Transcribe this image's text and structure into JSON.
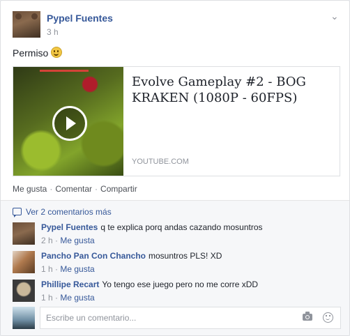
{
  "post": {
    "author": "Pypel Fuentes",
    "time": "3 h",
    "status_text": "Permiso",
    "link": {
      "title": "Evolve Gameplay #2 - BOG KRAKEN (1080P - 60FPS)",
      "domain": "YOUTUBE.COM"
    },
    "actions": {
      "like": "Me gusta",
      "comment": "Comentar",
      "share": "Compartir",
      "separator": "·"
    }
  },
  "comments": {
    "view_more": "Ver 2 comentarios más",
    "items": [
      {
        "name": "Pypel Fuentes",
        "text": "q te explica porq andas cazando mosuntros",
        "time": "2 h",
        "like": "Me gusta",
        "dot": "·"
      },
      {
        "name": "Pancho Pan Con Chancho",
        "text": "mosuntros PLS! XD",
        "time": "1 h",
        "like": "Me gusta",
        "dot": "·"
      },
      {
        "name": "Phillipe Recart",
        "text": "Yo tengo ese juego pero no me corre xDD",
        "time": "1 h",
        "like": "Me gusta",
        "dot": "·"
      }
    ],
    "reply_placeholder": "Escribe un comentario..."
  },
  "icons": {
    "post_menu": "chevron-down-icon",
    "emoji": "smile-emoji",
    "play": "play-icon",
    "camera": "camera-icon",
    "sticker": "smiley-icon",
    "comment_bubble": "comment-bubble-icon"
  },
  "colors": {
    "link_blue": "#365899",
    "meta_gray": "#90949c",
    "text": "#1d2129",
    "comment_bg": "#f6f7f9"
  }
}
